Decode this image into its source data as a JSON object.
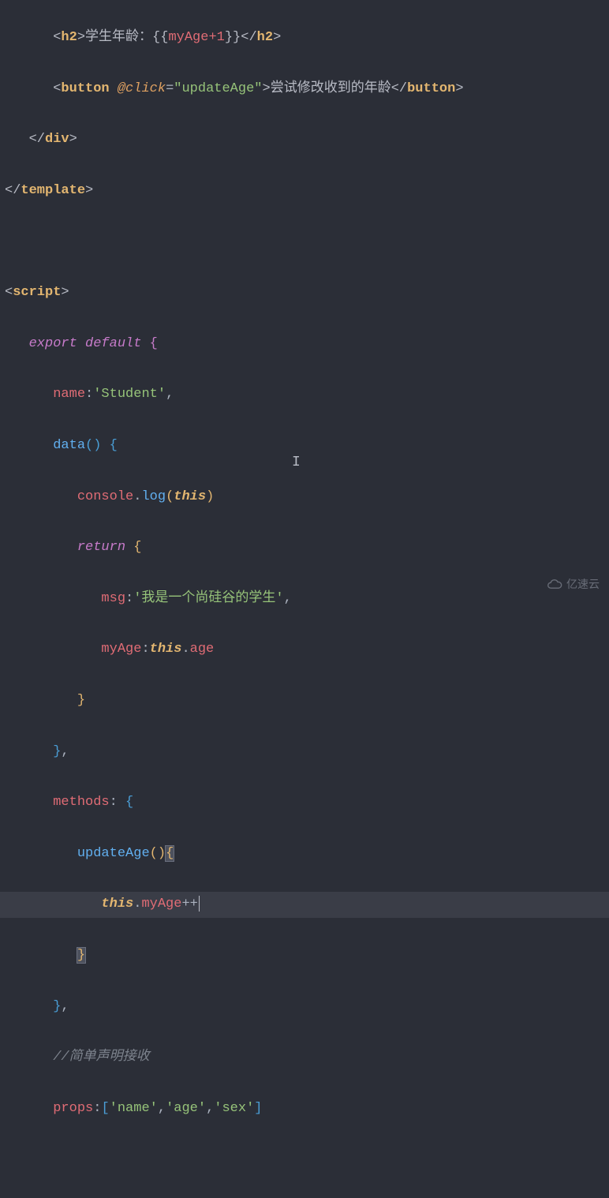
{
  "code": {
    "l1_tag_h2_open": "h2",
    "l1_text_a": "学生年龄：",
    "l1_expr": "myAge+1",
    "l1_tag_h2_close": "h2",
    "l2_tag_button_open": "button",
    "l2_attr_name": "@click",
    "l2_attr_val": "updateAge",
    "l2_text": "尝试修改收到的年龄",
    "l2_tag_button_close": "button",
    "l3_tag_div_close": "div",
    "l4_tag_template_close": "template",
    "l6_tag_script_open": "script",
    "l7_export": "export",
    "l7_default": "default",
    "l8_name_key": "name",
    "l8_name_val": "'Student'",
    "l9_data": "data",
    "l10_console": "console",
    "l10_log": "log",
    "l10_this": "this",
    "l11_return": "return",
    "l12_msg_key": "msg",
    "l12_msg_val": "'我是一个尚硅谷的学生'",
    "l13_myage_key": "myAge",
    "l13_this": "this",
    "l13_age": "age",
    "l16_methods": "methods",
    "l17_updateAge": "updateAge",
    "l18_this": "this",
    "l18_myage": "myAge",
    "l18_inc": "++",
    "l21_comment": "//简单声明接收",
    "l22_props": "props",
    "l22_item1": "'name'",
    "l22_item2": "'age'",
    "l22_item3": "'sex'"
  },
  "watermark": {
    "text": "亿速云"
  }
}
